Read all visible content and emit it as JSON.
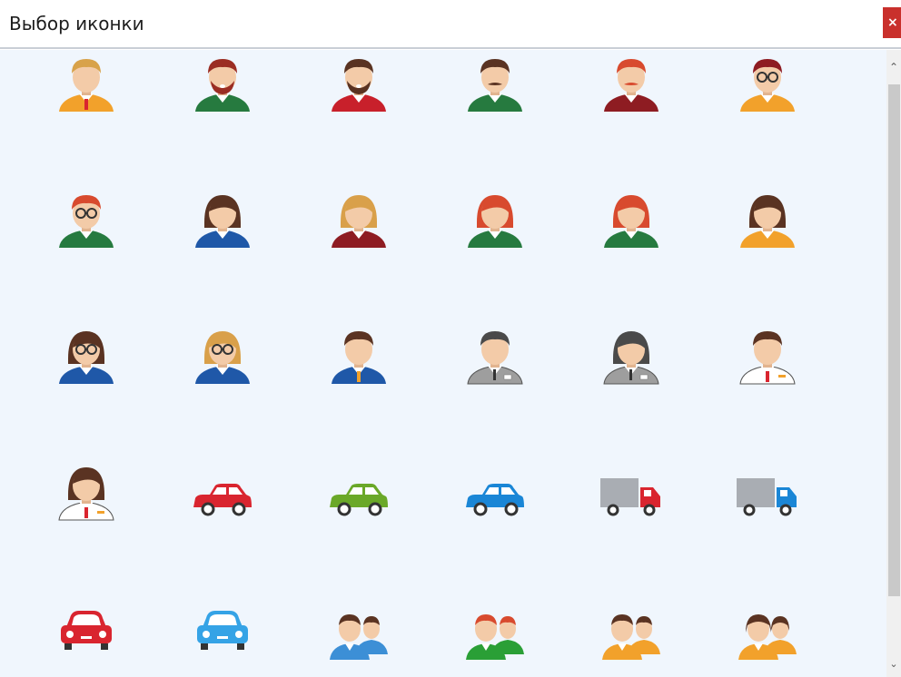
{
  "window": {
    "title": "Выбор иконки",
    "close_label": "×"
  },
  "scrollbar": {
    "up": "⌃",
    "down": "⌄"
  },
  "icons": [
    {
      "kind": "person",
      "hair": "#d8a24a",
      "shirt": "#f2a12b",
      "style": "man"
    },
    {
      "kind": "person",
      "hair": "#9b2d23",
      "shirt": "#267a3f",
      "style": "beard",
      "beard": "#9b2d23"
    },
    {
      "kind": "person",
      "hair": "#5a3322",
      "shirt": "#c8202b",
      "style": "beard",
      "beard": "#5a3322"
    },
    {
      "kind": "person",
      "hair": "#5a3322",
      "shirt": "#267a3f",
      "style": "mustache",
      "beard": "#5a3322"
    },
    {
      "kind": "person",
      "hair": "#d84a2e",
      "shirt": "#8e1c22",
      "style": "mustache",
      "beard": "#d84a2e"
    },
    {
      "kind": "person",
      "hair": "#8e1c22",
      "shirt": "#f2a12b",
      "style": "glasses"
    },
    {
      "kind": "person",
      "hair": "#d84a2e",
      "shirt": "#267a3f",
      "style": "glasses"
    },
    {
      "kind": "person",
      "hair": "#5a3322",
      "shirt": "#1f58a8",
      "style": "woman"
    },
    {
      "kind": "person",
      "hair": "#d9a04a",
      "shirt": "#8e1c22",
      "style": "woman"
    },
    {
      "kind": "person",
      "hair": "#d84a2e",
      "shirt": "#267a3f",
      "style": "woman"
    },
    {
      "kind": "person",
      "hair": "#d84a2e",
      "shirt": "#267a3f",
      "style": "woman"
    },
    {
      "kind": "person",
      "hair": "#5a3322",
      "shirt": "#f2a12b",
      "style": "woman"
    },
    {
      "kind": "person",
      "hair": "#5a3322",
      "shirt": "#1f58a8",
      "style": "woman-glasses"
    },
    {
      "kind": "person",
      "hair": "#d9a04a",
      "shirt": "#1f58a8",
      "style": "woman-glasses"
    },
    {
      "kind": "person",
      "hair": "#5a3322",
      "shirt": "#1f58a8",
      "style": "suit"
    },
    {
      "kind": "person",
      "hair": "#4a4a4a",
      "shirt": "#9e9e9e",
      "style": "suit-gray"
    },
    {
      "kind": "person",
      "hair": "#4a4a4a",
      "shirt": "#9e9e9e",
      "style": "woman-gray"
    },
    {
      "kind": "person",
      "hair": "#5a3322",
      "shirt": "#ffffff",
      "style": "suit-white"
    },
    {
      "kind": "person",
      "hair": "#5a3322",
      "shirt": "#ffffff",
      "style": "woman-white"
    },
    {
      "kind": "car",
      "color": "#d9252f"
    },
    {
      "kind": "car",
      "color": "#6aa828"
    },
    {
      "kind": "car",
      "color": "#1a86d6"
    },
    {
      "kind": "truck",
      "color": "#d9252f"
    },
    {
      "kind": "truck",
      "color": "#1a86d6"
    },
    {
      "kind": "car-front",
      "color": "#d9252f"
    },
    {
      "kind": "car-front",
      "color": "#35a3e6"
    },
    {
      "kind": "group",
      "color": "#3c8fd6"
    },
    {
      "kind": "group",
      "color": "#2a9f36",
      "hair": "#d84a2e"
    },
    {
      "kind": "group",
      "color": "#f2a12b"
    },
    {
      "kind": "group",
      "color": "#f2a12b",
      "style": "women"
    }
  ]
}
